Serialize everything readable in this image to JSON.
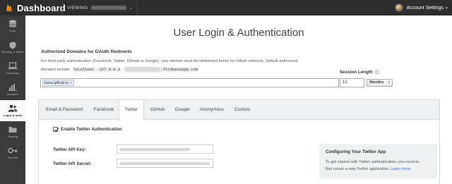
{
  "topbar": {
    "brand_title": "Dashboard",
    "viewing_label": "VIEWING",
    "viewing_value": "",
    "account_label": "Account Settings"
  },
  "sidebar": {
    "items": [
      {
        "label": "Data",
        "icon": "database-icon"
      },
      {
        "label": "Security & Rules",
        "icon": "shield-icon"
      },
      {
        "label": "Simulator",
        "icon": "laptop-icon"
      },
      {
        "label": "Analytics",
        "icon": "bar-chart-icon"
      },
      {
        "label": "Login & Auth",
        "icon": "users-icon",
        "active": true
      },
      {
        "label": "Hosting",
        "icon": "folder-icon"
      },
      {
        "label": "Secrets",
        "icon": "key-icon"
      }
    ]
  },
  "main": {
    "page_title": "User Login & Authentication",
    "domains_title": "Authorized Domains for OAuth Redirects",
    "desc_line1": "For third-party authentication (Facebook, Twitter, GitHub or Google), your domain must be whitelisted below for OAuth redirects. Default authorized",
    "desc_line2_prefix": "domains include:",
    "default_domain_1": "localhost",
    "default_domain_2": "127.0.0.1",
    "default_domain_3_suffix": ".firebaseapp.com",
    "domain_tag": "kana.github.io",
    "domain_tag_remove": "×",
    "session_length_label": "Session Length",
    "session_length_value": "12",
    "session_unit": "Months"
  },
  "tabs": [
    "Email & Password",
    "Facebook",
    "Twitter",
    "GitHub",
    "Google",
    "Anonymous",
    "Custom"
  ],
  "active_tab": "Twitter",
  "twitter": {
    "enable_label": "Enable Twitter Authentication",
    "enabled": true,
    "api_key_label": "Twitter API Key:",
    "api_secret_label": "Twitter API Secret:"
  },
  "info": {
    "title": "Configuring Your Twitter App",
    "text_line1": "To get started with Twitter authentication, you need to",
    "text_line2": "first create a new Twitter application.",
    "link": "Learn more"
  },
  "colors": {
    "topbar": "#2d2d2d",
    "sidebar": "#3a3a3a",
    "link": "#2a7ad5"
  }
}
